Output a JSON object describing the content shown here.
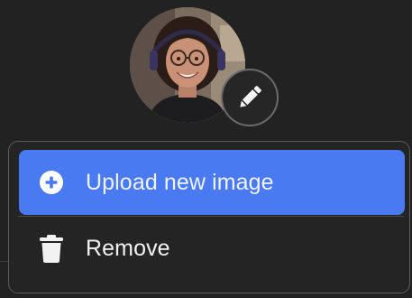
{
  "profile": {
    "avatar_icon": "profile-photo",
    "edit_icon": "pencil-icon"
  },
  "menu": {
    "items": [
      {
        "label": "Upload new image",
        "icon": "plus-circle-icon",
        "highlighted": true
      },
      {
        "label": "Remove",
        "icon": "trash-icon",
        "highlighted": false
      }
    ]
  },
  "colors": {
    "background": "#222222",
    "accent": "#4a7af2",
    "menu_border": "#5c5c5c",
    "text": "#f2f2f2"
  }
}
